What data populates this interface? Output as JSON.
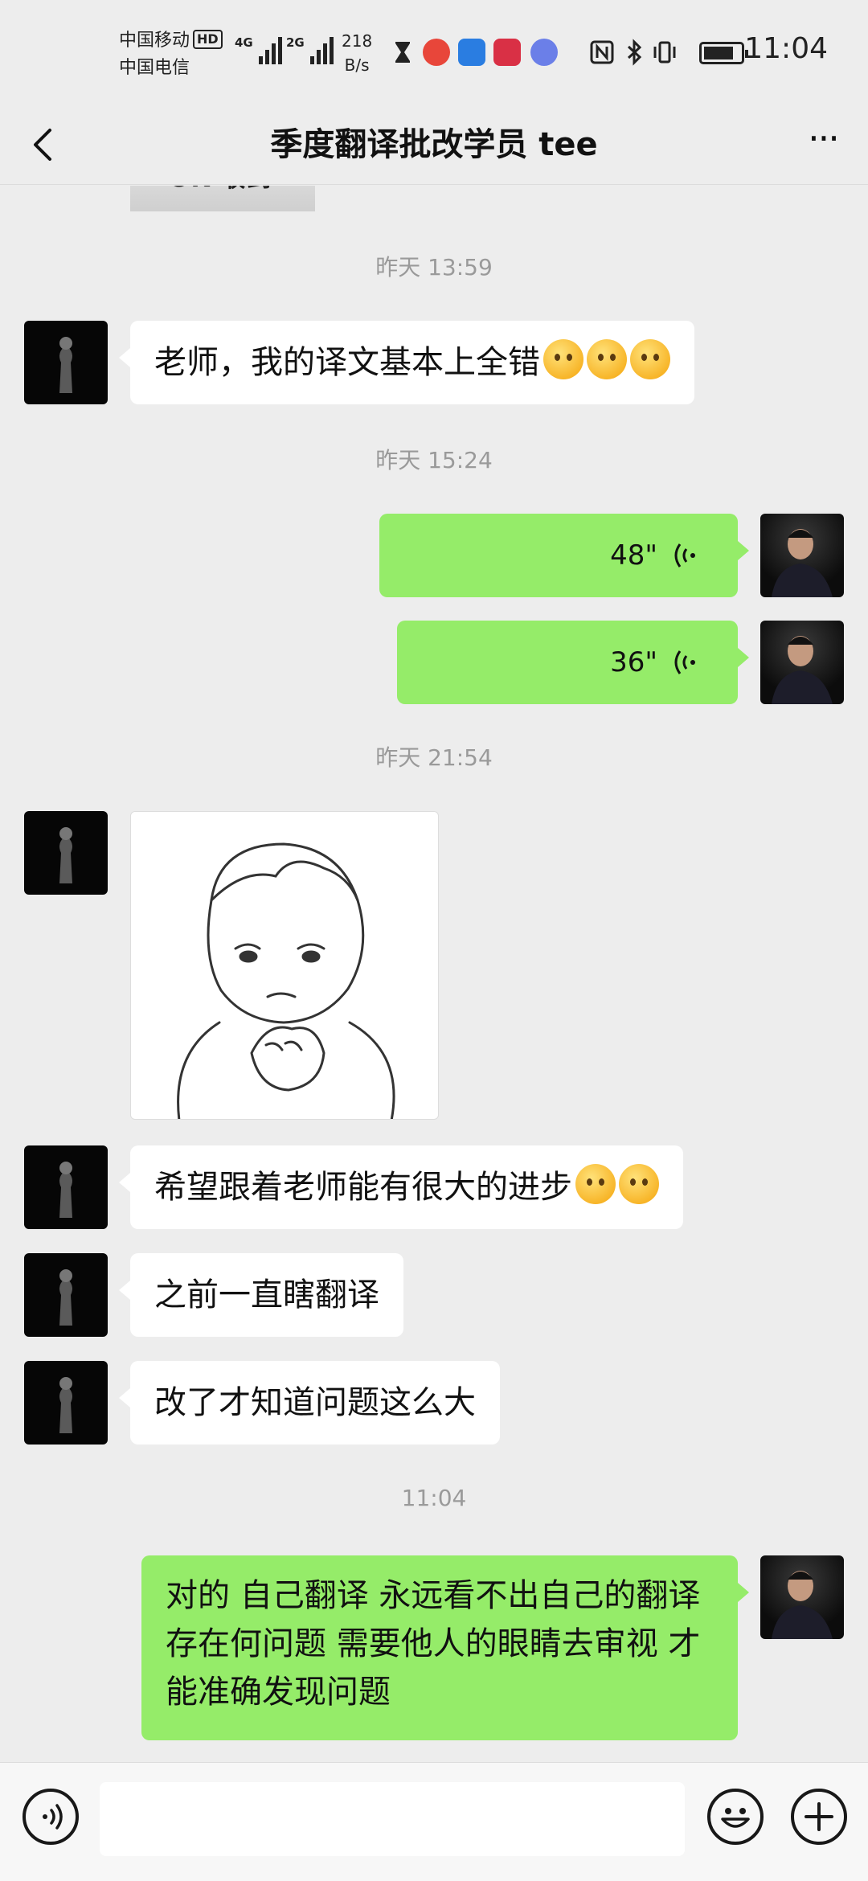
{
  "status_bar": {
    "carrier_1": "中国移动",
    "carrier_1_badge": "HD",
    "carrier_2": "中国电信",
    "network_1": "4G",
    "network_2": "2G",
    "speed_value": "218",
    "speed_unit": "B/s",
    "time": "11:04",
    "icons": [
      "hourglass-icon",
      "search-app-icon",
      "app-icon",
      "book-app-icon",
      "music-icon",
      "nfc-icon",
      "bluetooth-icon",
      "vibrate-icon",
      "battery-icon"
    ]
  },
  "nav": {
    "title": "季度翻译批改学员 tee",
    "more_label": "···"
  },
  "chat": {
    "cropped_image_text": "OK 收到",
    "messages": [
      {
        "type": "timestamp",
        "text": "昨天 13:59"
      },
      {
        "type": "text",
        "side": "left",
        "text": "老师，我的译文基本上全错",
        "emojis": [
          "flushed-face-emoji",
          "crying-face-emoji",
          "crying-face-emoji"
        ]
      },
      {
        "type": "timestamp",
        "text": "昨天 15:24"
      },
      {
        "type": "voice",
        "side": "right",
        "duration": "48\""
      },
      {
        "type": "voice",
        "side": "right",
        "duration": "36\""
      },
      {
        "type": "timestamp",
        "text": "昨天 21:54"
      },
      {
        "type": "sticker",
        "side": "left",
        "description": "baby-fist-sticker"
      },
      {
        "type": "text",
        "side": "left",
        "text": "希望跟着老师能有很大的进步",
        "emojis": [
          "crying-face-emoji",
          "smiling-face-emoji"
        ]
      },
      {
        "type": "text",
        "side": "left",
        "text": "之前一直瞎翻译"
      },
      {
        "type": "text",
        "side": "left",
        "text": "改了才知道问题这么大"
      },
      {
        "type": "timestamp",
        "text": "11:04"
      },
      {
        "type": "text",
        "side": "right",
        "text": "对的 自己翻译 永远看不出自己的翻译存在何问题 需要他人的眼睛去审视 才能准确发现问题"
      }
    ]
  },
  "input_bar": {
    "voice_button": "voice-input-icon",
    "text_value": "",
    "emoji_button": "emoji-icon",
    "plus_button": "plus-icon"
  },
  "colors": {
    "background": "#ededed",
    "bubble_right": "#95ec69",
    "bubble_left": "#ffffff",
    "timestamp": "#9a9a9a"
  }
}
